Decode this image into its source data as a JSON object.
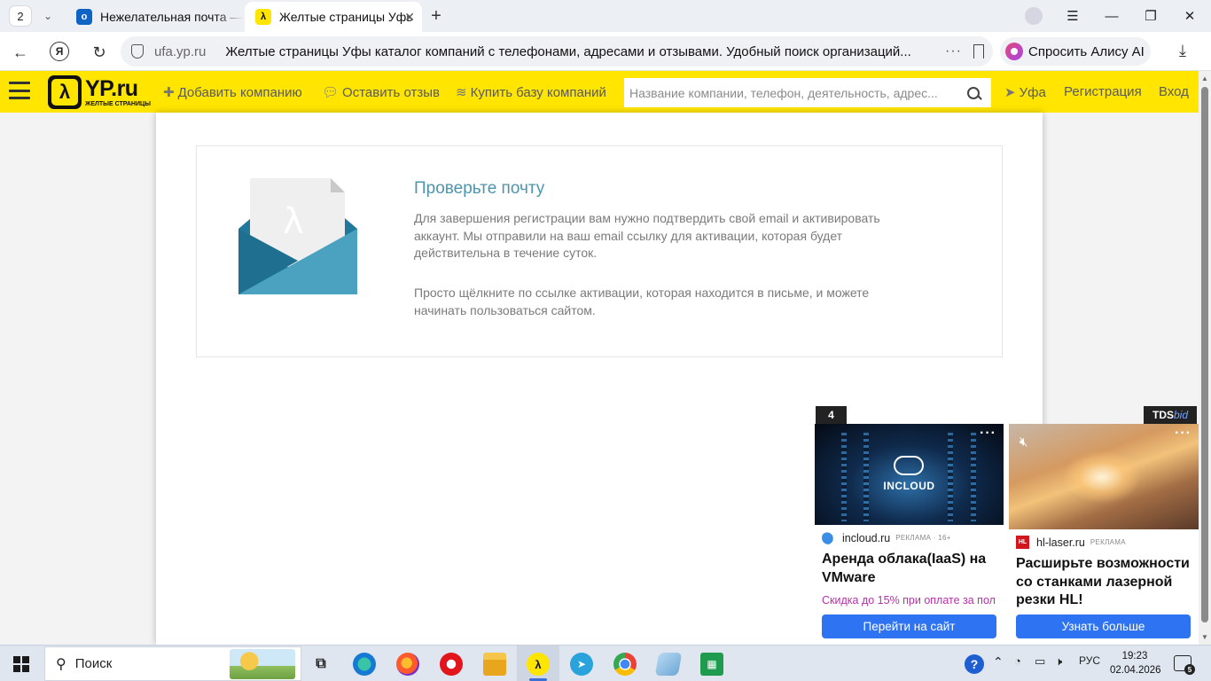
{
  "browser": {
    "tab_count": "2",
    "tabs": [
      {
        "title": "Нежелательная почта — I",
        "icon": "outlook-icon",
        "active": false
      },
      {
        "title": "Желтые страницы Уфы",
        "icon": "yp-icon",
        "active": true
      }
    ],
    "address": {
      "host": "ufa.yp.ru",
      "page_title": "Желтые страницы Уфы каталог компаний с телефонами, адресами и отзывами. Удобный поиск организаций..."
    },
    "alice_label": "Спросить Алису AI"
  },
  "site": {
    "logo_text": "YP.ru",
    "logo_sub": "ЖЕЛТЫЕ СТРАНИЦЫ",
    "nav": {
      "add_company": "Добавить компанию",
      "leave_review": "Оставить отзыв",
      "buy_db": "Купить базу компаний"
    },
    "search_placeholder": "Название компании, телефон, деятельность, адрес...",
    "city": "Уфа",
    "register": "Регистрация",
    "login": "Вход",
    "colors": {
      "header_bg": "#ffe500",
      "title": "#4d95ad",
      "envelope_dark": "#20789b",
      "envelope_light": "#4aa2c0"
    }
  },
  "notice": {
    "title": "Проверьте почту",
    "paragraph1": "Для завершения регистрации вам нужно подтвердить свой email и активировать аккаунт. Мы отправили на ваш email ссылку для активации, которая будет действительна в течение суток.",
    "paragraph2": "Просто щёлкните по ссылке активации, которая находится в письме, и можете начинать пользоваться сайтом."
  },
  "ads": {
    "counter": "4",
    "network": "TDS",
    "network_suffix": "bid",
    "items": [
      {
        "image_text": "INCLOUD",
        "domain": "incloud.ru",
        "label": "РЕКЛАМА · 16+",
        "title": "Аренда облака(IaaS) на VMware",
        "promo": "Скидка до 15% при оплате за пол",
        "button": "Перейти на сайт"
      },
      {
        "logo_text": "HL",
        "domain": "hl-laser.ru",
        "label": "РЕКЛАМА",
        "title": "Расширьте возможности со станками лазерной резки HL!",
        "button": "Узнать больше"
      }
    ]
  },
  "taskbar": {
    "search_label": "Поиск",
    "lang": "РУС",
    "time": "19:23",
    "date": "02.04.2026",
    "notifications": "5"
  }
}
